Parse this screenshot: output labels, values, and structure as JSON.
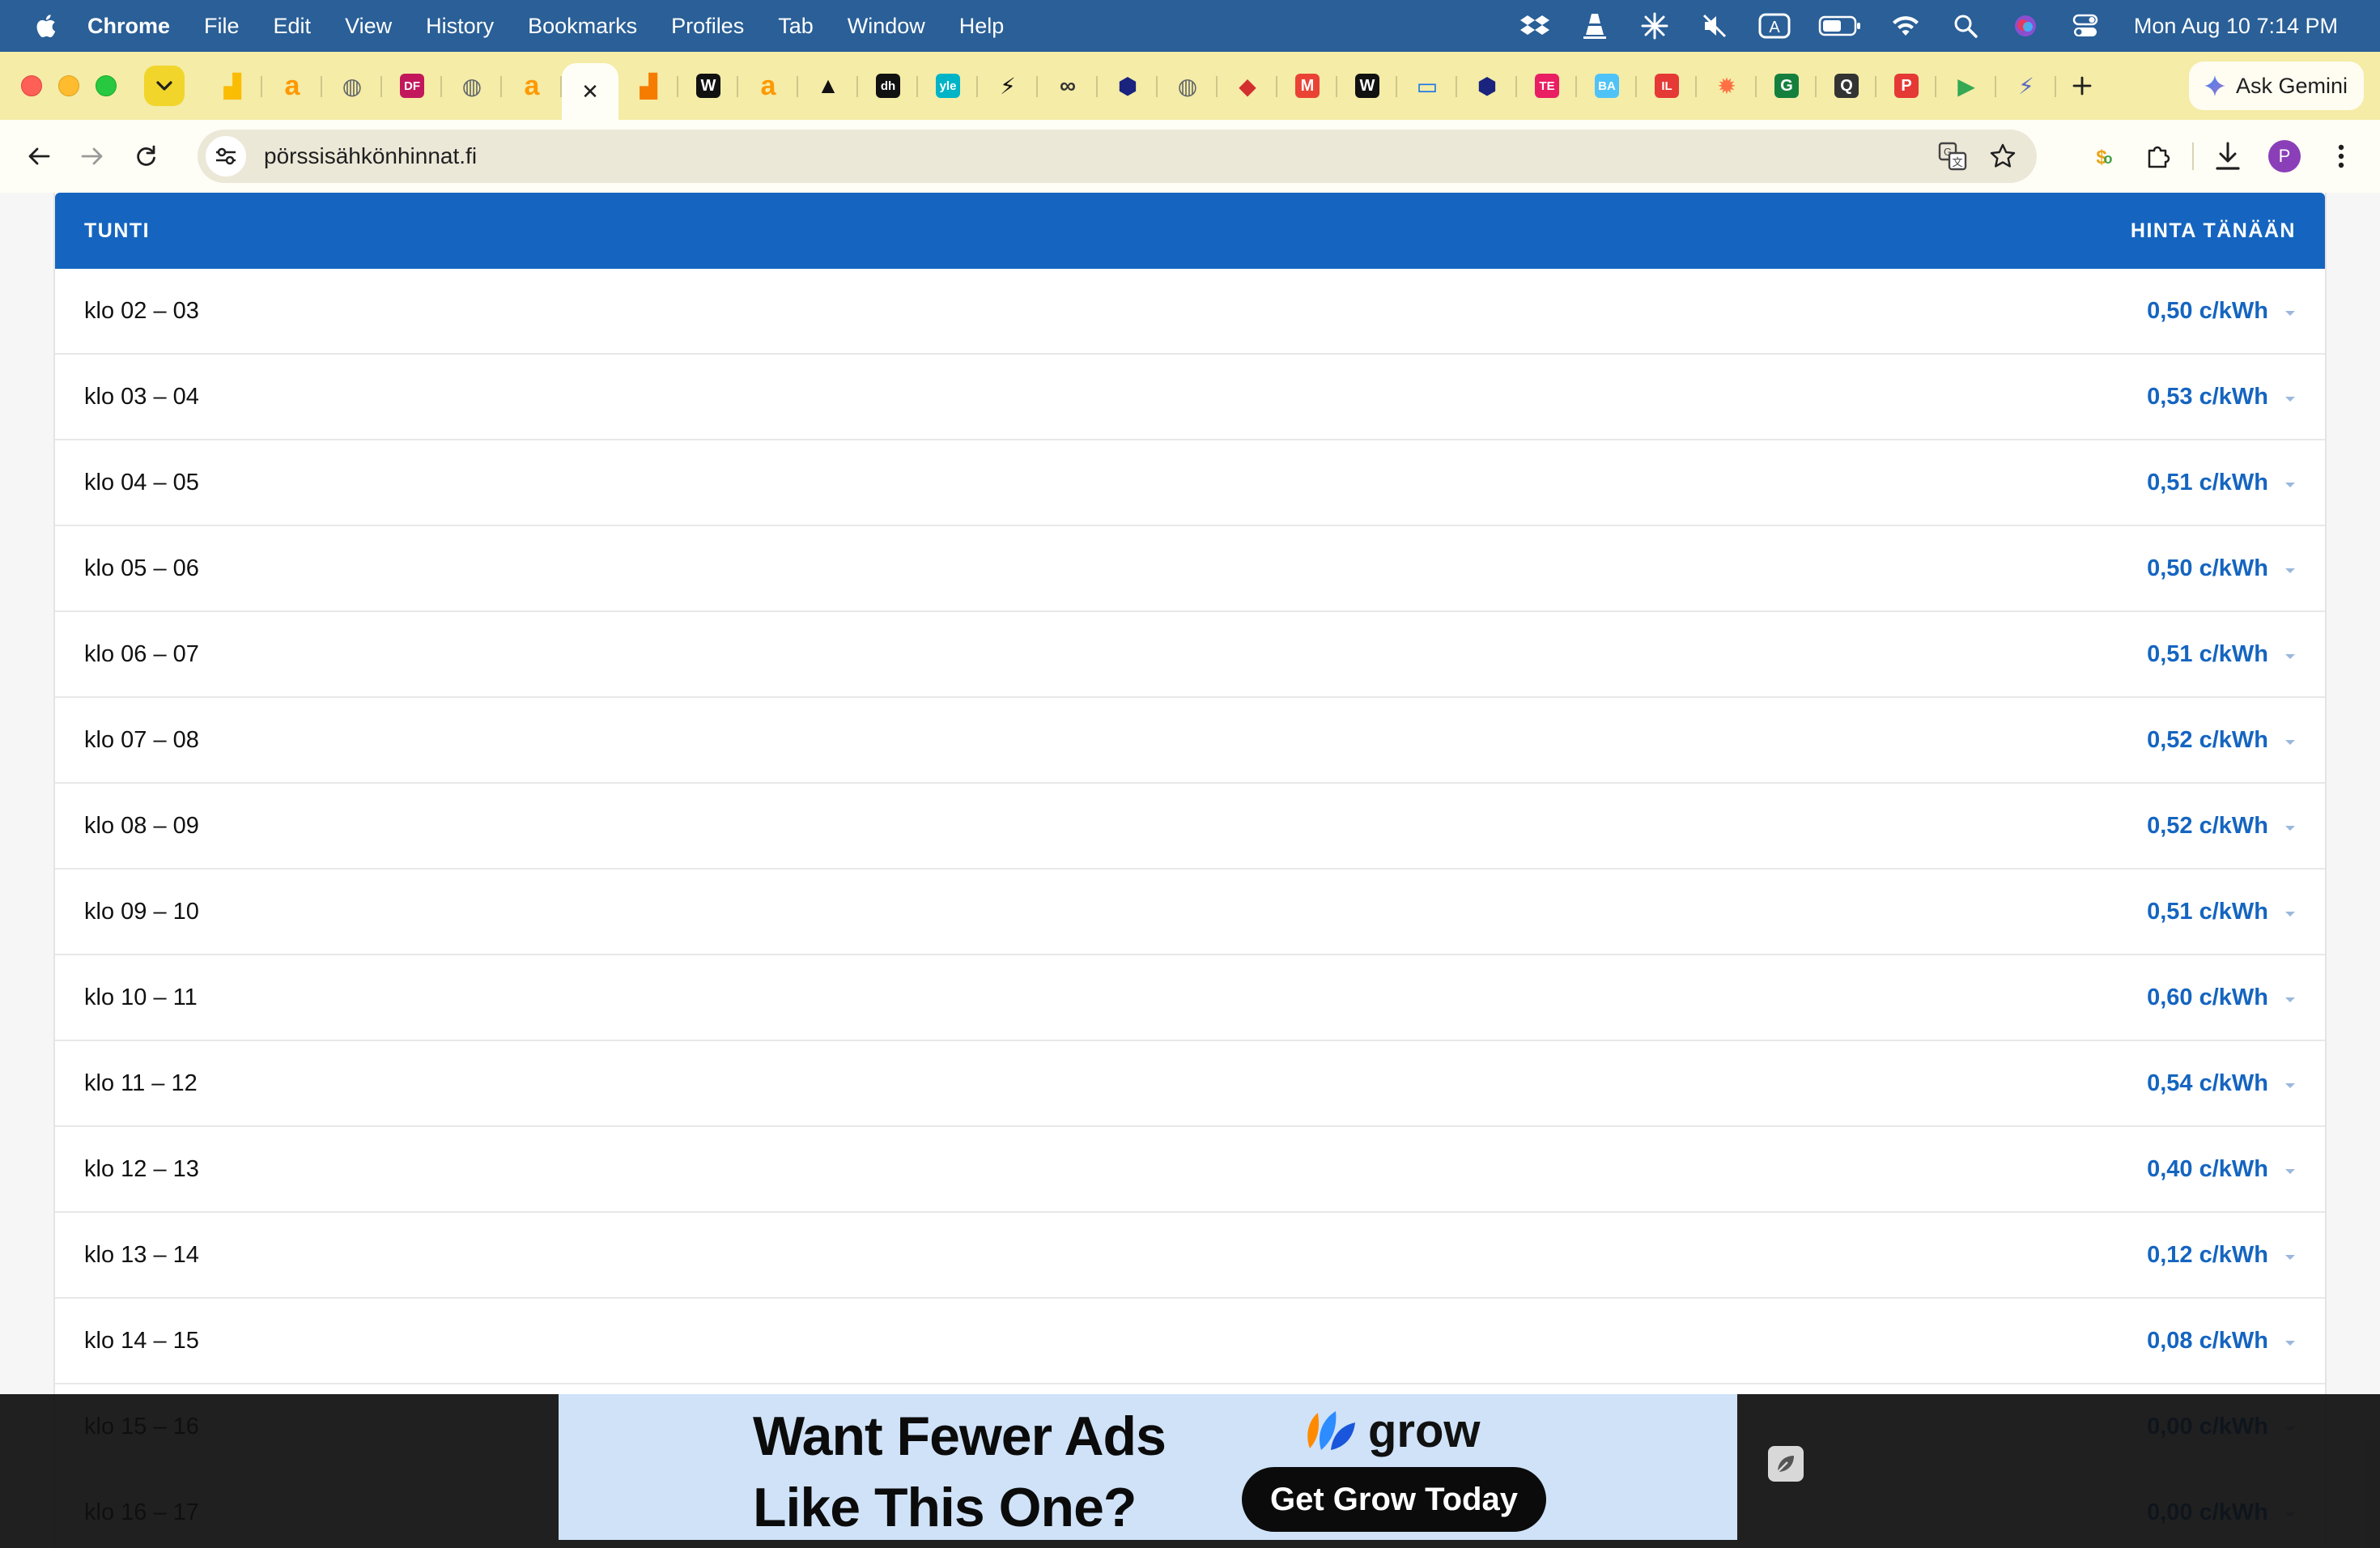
{
  "menubar": {
    "app_name": "Chrome",
    "items": [
      "File",
      "Edit",
      "View",
      "History",
      "Bookmarks",
      "Profiles",
      "Tab",
      "Window",
      "Help"
    ],
    "clock": "Mon Aug 10  7:14 PM",
    "status_icons": [
      "dropbox-icon",
      "vlc-icon",
      "perplexity-icon",
      "mute-icon",
      "input-source-icon",
      "battery-icon",
      "wifi-icon",
      "spotlight-icon",
      "siri-icon",
      "control-center-icon"
    ]
  },
  "tabs": {
    "active_close_glyph": "✕",
    "new_tab_glyph": "+",
    "ask_gemini_label": "Ask Gemini",
    "pinned": [
      {
        "icon": "google-ads-icon",
        "glyph": "▟",
        "color": "#fbbc04"
      },
      {
        "icon": "amazon-icon",
        "glyph": "a",
        "color": "#ff9900"
      },
      {
        "icon": "globe-icon",
        "glyph": "◍",
        "color": "#5f6368"
      },
      {
        "icon": "df-icon",
        "glyph": "DF",
        "color": "#c2185b"
      },
      {
        "icon": "globe-icon",
        "glyph": "◍",
        "color": "#5f6368"
      },
      {
        "icon": "amazon-icon",
        "glyph": "a",
        "color": "#ff9900"
      },
      {
        "icon": "active-tab-close-icon",
        "glyph": "✕",
        "color": "#1f1f1f"
      },
      {
        "icon": "analytics-icon",
        "glyph": "▟",
        "color": "#f57c00"
      },
      {
        "icon": "wolt-icon",
        "glyph": "W",
        "color": "#111111"
      },
      {
        "icon": "amazon-icon",
        "glyph": "a",
        "color": "#ff9900"
      },
      {
        "icon": "arc-icon",
        "glyph": "▲",
        "color": "#111111"
      },
      {
        "icon": "dh-icon",
        "glyph": "dh",
        "color": "#111111"
      },
      {
        "icon": "yle-icon",
        "glyph": "yle",
        "color": "#00b4c8"
      },
      {
        "icon": "bolt-icon",
        "glyph": "⚡",
        "color": "#111111"
      },
      {
        "icon": "link-icon",
        "glyph": "∞",
        "color": "#333333"
      },
      {
        "icon": "hexagon-icon",
        "glyph": "⬢",
        "color": "#1a237e"
      },
      {
        "icon": "globe-icon",
        "glyph": "◍",
        "color": "#5f6368"
      },
      {
        "icon": "maps-pin-icon",
        "glyph": "◆",
        "color": "#d32f2f"
      },
      {
        "icon": "gmail-icon",
        "glyph": "M",
        "color": "#ea4335"
      },
      {
        "icon": "w-icon",
        "glyph": "W",
        "color": "#111111"
      },
      {
        "icon": "chat-icon",
        "glyph": "▭",
        "color": "#1a73e8"
      },
      {
        "icon": "hexagon-icon",
        "glyph": "⬢",
        "color": "#1a237e"
      },
      {
        "icon": "te-icon",
        "glyph": "TE",
        "color": "#e91e63"
      },
      {
        "icon": "ba-icon",
        "glyph": "BA",
        "color": "#4fc3f7"
      },
      {
        "icon": "il-icon",
        "glyph": "IL",
        "color": "#e53935"
      },
      {
        "icon": "fox-icon",
        "glyph": "✹",
        "color": "#ff7043"
      },
      {
        "icon": "grammarly-icon",
        "glyph": "G",
        "color": "#15803d"
      },
      {
        "icon": "search-q-icon",
        "glyph": "Q",
        "color": "#333333"
      },
      {
        "icon": "p-icon",
        "glyph": "P",
        "color": "#e53935"
      },
      {
        "icon": "play-icon",
        "glyph": "▶",
        "color": "#34a853"
      },
      {
        "icon": "lightning-icon",
        "glyph": "⚡",
        "color": "#5c6bc0"
      }
    ]
  },
  "omnibox": {
    "url": "pörssisähkönhinnat.fi"
  },
  "price_table": {
    "header_hour": "TUNTI",
    "header_price": "HINTA TÄNÄÄN",
    "accent_color": "#1565c0",
    "rows": [
      {
        "hour": "klo 02 – 03",
        "price": "0,50 c/kWh"
      },
      {
        "hour": "klo 03 – 04",
        "price": "0,53 c/kWh"
      },
      {
        "hour": "klo 04 – 05",
        "price": "0,51 c/kWh"
      },
      {
        "hour": "klo 05 – 06",
        "price": "0,50 c/kWh"
      },
      {
        "hour": "klo 06 – 07",
        "price": "0,51 c/kWh"
      },
      {
        "hour": "klo 07 – 08",
        "price": "0,52 c/kWh"
      },
      {
        "hour": "klo 08 – 09",
        "price": "0,52 c/kWh"
      },
      {
        "hour": "klo 09 – 10",
        "price": "0,51 c/kWh"
      },
      {
        "hour": "klo 10 – 11",
        "price": "0,60 c/kWh"
      },
      {
        "hour": "klo 11 – 12",
        "price": "0,54 c/kWh"
      },
      {
        "hour": "klo 12 – 13",
        "price": "0,40 c/kWh"
      },
      {
        "hour": "klo 13 – 14",
        "price": "0,12 c/kWh"
      },
      {
        "hour": "klo 14 – 15",
        "price": "0,08 c/kWh"
      },
      {
        "hour": "klo 15 – 16",
        "price": "0,00 c/kWh"
      },
      {
        "hour": "klo 16 – 17",
        "price": "0,00 c/kWh"
      }
    ]
  },
  "ad": {
    "headline_line1": "Want Fewer Ads",
    "headline_line2": "Like This One?",
    "brand": "grow",
    "cta": "Get Grow Today"
  }
}
